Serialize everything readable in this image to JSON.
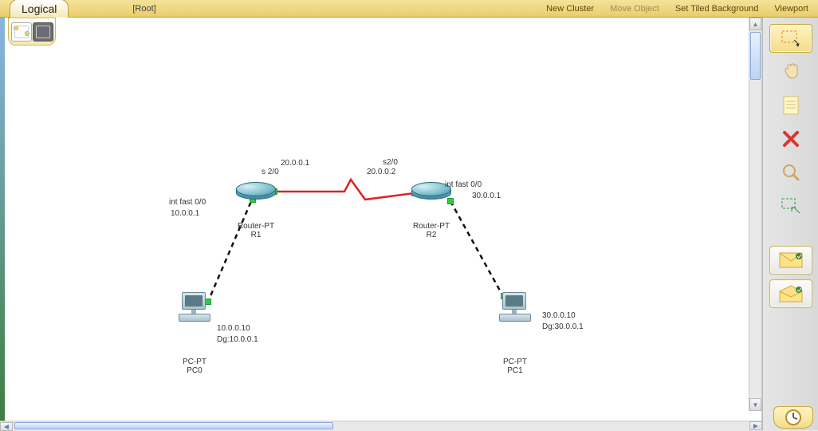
{
  "topbar": {
    "view": "Logical",
    "breadcrumb": "[Root]",
    "new_cluster": "New Cluster",
    "move_object": "Move Object",
    "tiled_bg": "Set Tiled Background",
    "viewport": "Viewport"
  },
  "devices": {
    "r1": {
      "model": "Router-PT",
      "name": "R1"
    },
    "r2": {
      "model": "Router-PT",
      "name": "R2"
    },
    "pc0": {
      "model": "PC-PT",
      "name": "PC0"
    },
    "pc1": {
      "model": "PC-PT",
      "name": "PC1"
    }
  },
  "labels": {
    "r1_fast": "int fast 0/0",
    "r1_fast_ip": "10.0.0.1",
    "r1_serial": "s 2/0",
    "r1_serial_ip": "20.0.0.1",
    "r2_serial": "s2/0",
    "r2_serial_ip": "20.0.0.2",
    "r2_fast": "int fast 0/0",
    "r2_fast_ip": "30.0.0.1",
    "pc0_ip": "10.0.0.10",
    "pc0_dg": "Dg:10.0.0.1",
    "pc1_ip": "30.0.0.10",
    "pc1_dg": "Dg:30.0.0.1"
  },
  "tools": {
    "select": "select",
    "hand": "move-layout",
    "note": "place-note",
    "delete": "delete",
    "inspect": "inspect",
    "resize": "resize-shape",
    "simple_pdu": "add-simple-pdu",
    "complex_pdu": "add-complex-pdu"
  },
  "chart_data": {
    "type": "network-topology",
    "nodes": [
      {
        "id": "PC0",
        "type": "PC",
        "model": "PC-PT",
        "ip": "10.0.0.10",
        "default_gateway": "10.0.0.1"
      },
      {
        "id": "R1",
        "type": "Router",
        "model": "Router-PT",
        "interfaces": [
          {
            "name": "int fast 0/0",
            "ip": "10.0.0.1"
          },
          {
            "name": "s 2/0",
            "ip": "20.0.0.1"
          }
        ]
      },
      {
        "id": "R2",
        "type": "Router",
        "model": "Router-PT",
        "interfaces": [
          {
            "name": "s2/0",
            "ip": "20.0.0.2"
          },
          {
            "name": "int fast 0/0",
            "ip": "30.0.0.1"
          }
        ]
      },
      {
        "id": "PC1",
        "type": "PC",
        "model": "PC-PT",
        "ip": "30.0.0.10",
        "default_gateway": "30.0.0.1"
      }
    ],
    "links": [
      {
        "from": "PC0",
        "to": "R1",
        "type": "copper-crossover",
        "from_port": "",
        "to_port": "int fast 0/0",
        "status": "up"
      },
      {
        "from": "R1",
        "to": "R2",
        "type": "serial-dce",
        "from_port": "s 2/0",
        "to_port": "s2/0",
        "status": "up"
      },
      {
        "from": "R2",
        "to": "PC1",
        "type": "copper-crossover",
        "from_port": "int fast 0/0",
        "to_port": "",
        "status": "up"
      }
    ]
  }
}
